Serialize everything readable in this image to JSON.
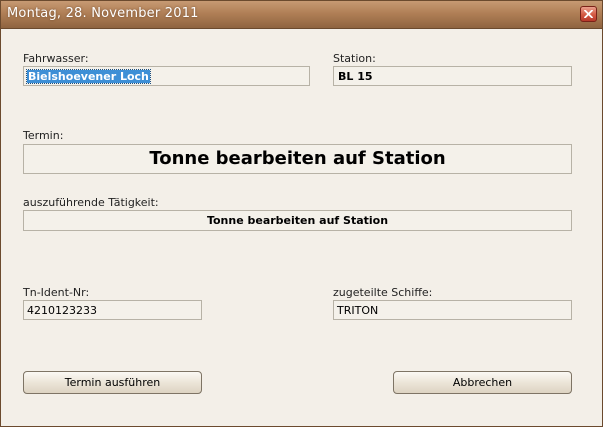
{
  "window": {
    "title": "Montag, 28. November 2011",
    "close_icon": "close-x-icon"
  },
  "form": {
    "fahrwasser": {
      "label": "Fahrwasser:",
      "value": "Bielshoevener Loch"
    },
    "station": {
      "label": "Station:",
      "value": "BL 15"
    },
    "termin": {
      "label": "Termin:",
      "value": "Tonne bearbeiten auf Station"
    },
    "taetigkeit": {
      "label": "auszuführende Tätigkeit:",
      "value": "Tonne bearbeiten auf Station"
    },
    "tn_ident": {
      "label": "Tn-Ident-Nr:",
      "value": "4210123233"
    },
    "schiffe": {
      "label": "zugeteilte Schiffe:",
      "value": "TRITON"
    }
  },
  "buttons": {
    "execute_label": "Termin ausführen",
    "cancel_label": "Abbrechen"
  }
}
